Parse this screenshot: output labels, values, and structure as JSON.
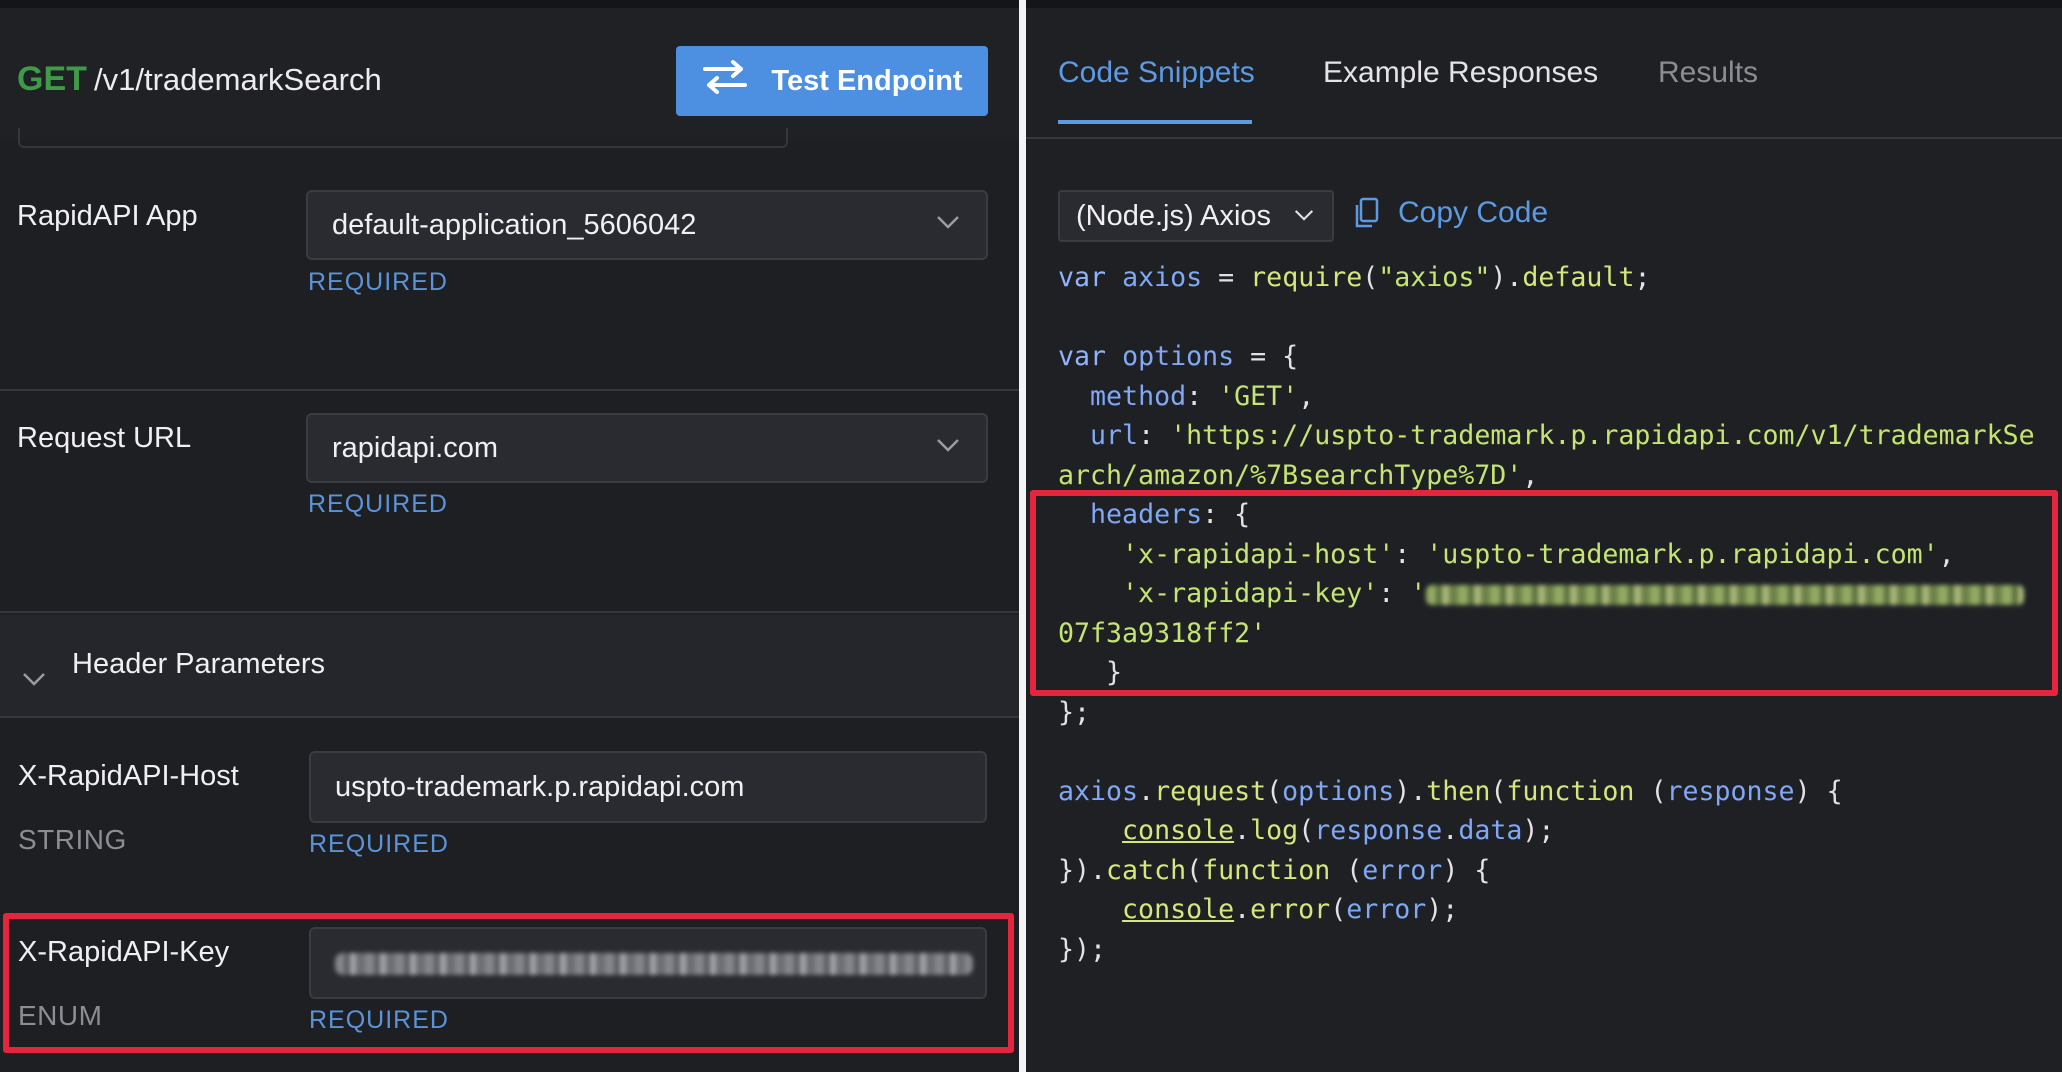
{
  "endpoint": {
    "method": "GET",
    "path": "/v1/trademarkSearch",
    "test_button_label": "Test Endpoint"
  },
  "app_param": {
    "label": "RapidAPI App",
    "value": "default-application_5606042",
    "required": "REQUIRED"
  },
  "url_param": {
    "label": "Request URL",
    "value": "rapidapi.com",
    "required": "REQUIRED"
  },
  "header_section": {
    "title": "Header Parameters"
  },
  "host_param": {
    "label": "X-RapidAPI-Host",
    "type": "STRING",
    "value": "uspto-trademark.p.rapidapi.com",
    "required": "REQUIRED"
  },
  "key_param": {
    "label": "X-RapidAPI-Key",
    "type": "ENUM",
    "required": "REQUIRED"
  },
  "tabs": [
    {
      "label": "Code Snippets",
      "active": true
    },
    {
      "label": "Example Responses",
      "active": false
    },
    {
      "label": "Results",
      "active": false
    }
  ],
  "code_panel": {
    "language": "(Node.js) Axios",
    "copy_label": "Copy Code"
  },
  "code": {
    "l1_kw": "var",
    "l1_var": "axios",
    "l1_fn": "require",
    "l1_str": "\"axios\"",
    "l1_prop": "default",
    "l3_kw": "var",
    "l3_var": "options",
    "method_key": "method",
    "method_val": "'GET'",
    "url_key": "url",
    "url_val_1": "'https://uspto-trademark.p.rapidapi.com/v1/trademarkSe",
    "url_val_2": "arch/amazon/%7BsearchType%7D'",
    "headers_key": "headers",
    "host_key": "'x-rapidapi-host'",
    "host_val": "'uspto-trademark.p.rapidapi.com'",
    "key_key": "'x-rapidapi-key'",
    "key_open": "'",
    "key_tail": "07f3a9318ff2'",
    "req_obj": "axios",
    "req_fn": "request",
    "req_arg": "options",
    "then_fn": "then",
    "fn_kw": "function",
    "resp_param": "response",
    "console": "console",
    "log_fn": "log",
    "resp_obj": "response",
    "data_prop": "data",
    "catch_fn": "catch",
    "err_param": "error",
    "error_fn": "error",
    "err_arg": "error"
  },
  "colors": {
    "accent": "#5c9ae4",
    "get_method": "#3f9b49",
    "highlight_box": "#e3253d"
  }
}
